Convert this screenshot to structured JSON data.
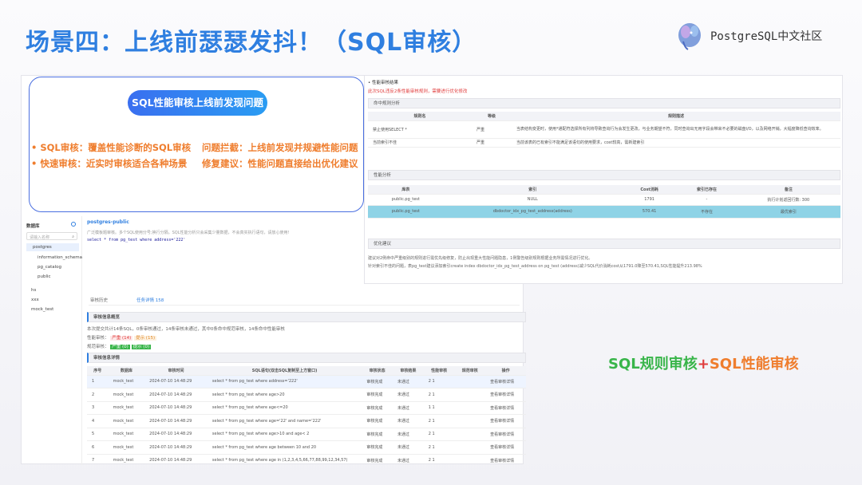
{
  "slide": {
    "title": "场景四：上线前瑟瑟发抖！（SQL审核）",
    "logo_text": "PostgreSQL中文社区",
    "callout_title": "SQL性能审核上线前发现问题",
    "bullets": [
      "•  SQL审核：覆盖性能诊断的SQL审核",
      "问题拦截：上线前发现并规避性能问题",
      "•  快速审核：近实时审核适合各种场景",
      "修复建议：性能问题直接给出优化建议"
    ],
    "subtitle_a": "SQL规则审核",
    "subtitle_plus": "+",
    "subtitle_b": "SQL性能审核",
    "colors": {
      "title": "#2f7fe0",
      "orange": "#ef7d2d",
      "green": "#39b54a"
    }
  },
  "app": {
    "sidebar": {
      "header": "数据库",
      "search_placeholder": "请输入名称",
      "items": [
        "postgres",
        "information_schema",
        "pg_catalog",
        "public",
        "hs",
        "xxx",
        "mock_test"
      ]
    },
    "editor": {
      "tab": "postgres-public",
      "hint": "广泛模板题审核。多个SQL使用分号;换行分隔。SQL性能分析只会采集少量数据，不会真实执行语句，请放心使用!",
      "sql": "select * from pg_test where address='222'"
    },
    "tabs": [
      "审核历史",
      "任务详情 158"
    ],
    "summary": {
      "section": "审核信息概览",
      "text": "本次提交共计14条SQL，0条审核通过，14条审核未通过，其中0条命中规范审核，14条命中性能审核",
      "perf_label": "性能审核：",
      "perf_tags": [
        "严重 (14)",
        "提示 (15)"
      ],
      "spec_label": "规范审核：",
      "spec_tags": [
        "严重 (0)",
        "提示 (0)"
      ]
    },
    "details": {
      "section": "审核信息详情",
      "headers": [
        "序号",
        "数据库",
        "审核时间",
        "SQL语句(双击SQL复制至上方窗口)",
        "审核状态",
        "审核结果",
        "性能审核",
        "规范审核",
        "操作"
      ],
      "rows": [
        [
          "1",
          "mock_test",
          "2024-07-10 14:48:29",
          "select * from pg_test where address='222'",
          "审核完成",
          "未通过",
          "2  1",
          "",
          "查看审核详情"
        ],
        [
          "2",
          "mock_test",
          "2024-07-10 14:48:29",
          "select * from pg_test where age>20",
          "审核完成",
          "未通过",
          "2  1",
          "",
          "查看审核详情"
        ],
        [
          "3",
          "mock_test",
          "2024-07-10 14:48:29",
          "select * from pg_test where age<=20",
          "审核完成",
          "未通过",
          "1  1",
          "",
          "查看审核详情"
        ],
        [
          "4",
          "mock_test",
          "2024-07-10 14:48:29",
          "select * from pg_test where age='22' and name='222'",
          "审核完成",
          "未通过",
          "2  1",
          "",
          "查看审核详情"
        ],
        [
          "5",
          "mock_test",
          "2024-07-10 14:48:29",
          "select * from pg_test where age>10 and age< 2",
          "审核完成",
          "未通过",
          "2  1",
          "",
          "查看审核详情"
        ],
        [
          "6",
          "mock_test",
          "2024-07-10 14:48:29",
          "select * from pg_test where age between 10 and 20",
          "审核完成",
          "未通过",
          "2  1",
          "",
          "查看审核详情"
        ],
        [
          "7",
          "mock_test",
          "2024-07-10 14:48:29",
          "select * from pg_test where age in (1,2,3,4,5,66,77,88,99,12,34,57)",
          "审核完成",
          "未通过",
          "2  1",
          "",
          "查看审核详情"
        ]
      ]
    }
  },
  "result": {
    "header": "• 性能审核结果",
    "warning": "此次SQL违反2条性能审核规则，需要进行优化修改",
    "rule_section": "命中规则分析",
    "rule_headers": [
      "规则名",
      "等级",
      "规则描述"
    ],
    "rules": [
      [
        "禁止使用SELECT *",
        "严重",
        "当表结构变更时，使用*通配符选择所有列将导致查询行为会发生更改，与业务期望不符，同时查询出无用字段会带来不必要的磁盘I/O，以及网络开销，大幅度降低查询效率。"
      ],
      [
        "当前索引不佳",
        "严重",
        "当前该表的已有索引不能满足该语句的使用要求，cost较高，需新建索引"
      ]
    ],
    "perf_section": "性能分析",
    "perf_headers": [
      "库表",
      "索引",
      "Cost消耗",
      "索引已存在",
      "备注"
    ],
    "perf_rows": [
      [
        "public.pg_test",
        "NULL",
        "1791",
        "-",
        "执行计划返回行数: 300"
      ],
      [
        "public.pg_test",
        "dbdoctor_idx_pg_test_address(address)",
        "570.41",
        "不存在",
        "最优索引"
      ]
    ],
    "advice_section": "优化建议",
    "advice_1": "建议对2例命中严重级别的规则进行需优先级修复，防止出现重大性能问题隐患，1例警告级别规则根据业务所需情况进行优化。",
    "advice_2": "针对索引不佳的问题，表pg_test建议添加索引create index dbdoctor_idx_pg_test_address on pg_test (address)减少SQL代价消耗cost从1791.0降至570.41,SQL性能提升213.98%"
  }
}
